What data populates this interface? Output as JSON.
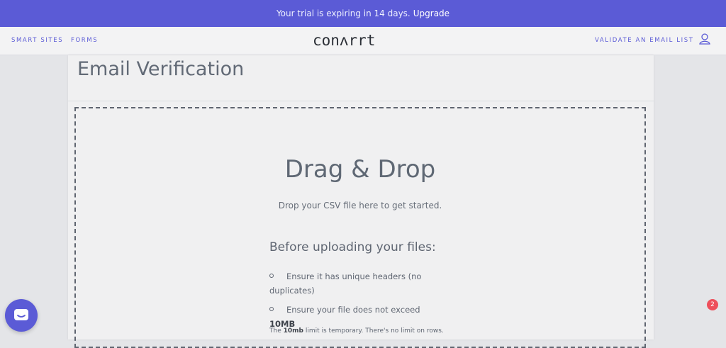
{
  "banner": {
    "message": "Your trial is expiring in 14 days.",
    "upgrade_label": "Upgrade"
  },
  "nav": {
    "smart_sites": "SMART SITES",
    "forms": "FORMS",
    "logo": "conᴧrrt",
    "validate": "VALIDATE AN EMAIL LIST",
    "user_icon": "user-icon"
  },
  "page": {
    "title": "Email Verification"
  },
  "dropzone": {
    "title": "Drag & Drop",
    "subtitle": "Drop your CSV file here to get started.",
    "requirements_heading": "Before uploading your files:",
    "requirements": [
      {
        "text": "Ensure it has unique headers (no duplicates)",
        "bold": ""
      },
      {
        "text": "Ensure your file does not exceed ",
        "bold": "10MB"
      }
    ],
    "note_prefix": "The ",
    "note_bold": "10mb",
    "note_suffix": " limit is temporary. There's no limit on rows."
  },
  "widgets": {
    "chat_icon": "chat-icon",
    "notification_count": "2"
  },
  "colors": {
    "accent": "#5b5bd6",
    "badge": "#ee4f5b"
  }
}
